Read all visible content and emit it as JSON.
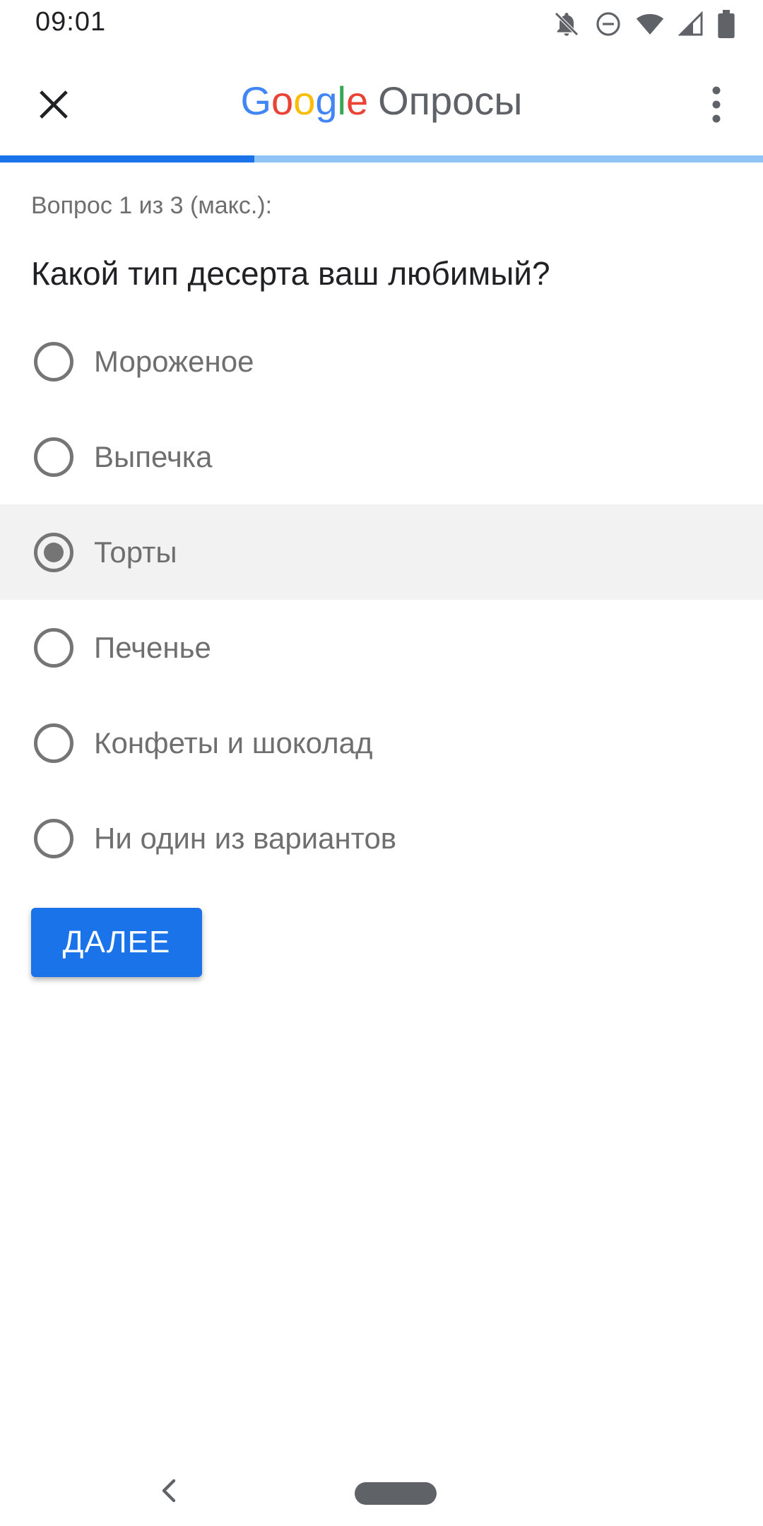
{
  "status_bar": {
    "time": "09:01",
    "icons": [
      "notifications-off-icon",
      "do-not-disturb-icon",
      "wifi-icon",
      "signal-icon",
      "battery-icon"
    ]
  },
  "app_bar": {
    "brand_letters": [
      "G",
      "o",
      "o",
      "g",
      "l",
      "e"
    ],
    "product_name": "Опросы",
    "close_icon": "close-icon",
    "menu_icon": "more-vert-icon"
  },
  "progress": {
    "fraction": 0.333,
    "fill_color": "#1a73e8",
    "track_color": "#90c4f4"
  },
  "question": {
    "counter": "Вопрос 1 из 3 (макс.):",
    "text": "Какой тип десерта ваш любимый?",
    "options": [
      {
        "label": "Мороженое",
        "selected": false
      },
      {
        "label": "Выпечка",
        "selected": false
      },
      {
        "label": "Торты",
        "selected": true
      },
      {
        "label": "Печенье",
        "selected": false
      },
      {
        "label": "Конфеты и шоколад",
        "selected": false
      },
      {
        "label": "Ни один из вариантов",
        "selected": false
      }
    ]
  },
  "actions": {
    "next_label": "ДАЛЕЕ"
  },
  "nav_bar": {
    "back_icon": "back-chevron-icon",
    "home_icon": "home-pill-icon"
  },
  "colors": {
    "accent": "#1a73e8",
    "google_blue": "#4285F4",
    "google_red": "#EA4335",
    "google_yellow": "#FBBC05",
    "google_green": "#34A853"
  }
}
